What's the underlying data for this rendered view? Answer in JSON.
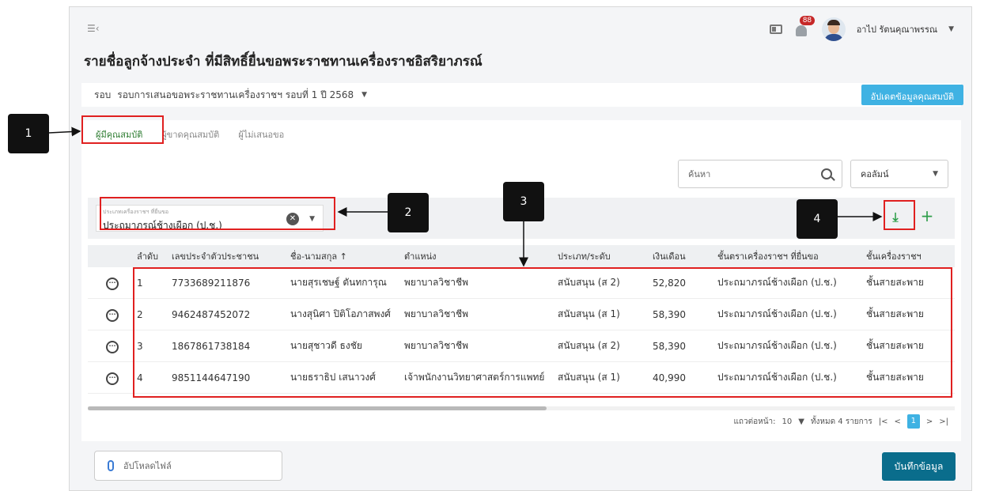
{
  "header": {
    "menu_icon": "menu-collapse-icon",
    "notification_count": "88",
    "user_name": "อาไป รัตนคุณาพรรณ",
    "page_title": "รายชื่อลูกจ้างประจำ ที่มีสิทธิ์ยื่นขอพระราชทานเครื่องราชอิสริยาภรณ์"
  },
  "round": {
    "label": "รอบ",
    "value": "รอบการเสนอขอพระราชทานเครื่องราชฯ รอบที่ 1 ปี 2568",
    "update_button": "อัปเดตข้อมูลคุณสมบัติ"
  },
  "tabs": [
    {
      "label": "ผู้มีคุณสมบัติ",
      "active": true
    },
    {
      "label": "ผู้ขาดคุณสมบัติ",
      "active": false
    },
    {
      "label": "ผู้ไม่เสนอขอ",
      "active": false
    }
  ],
  "search": {
    "placeholder": "ค้นหา"
  },
  "column_select": {
    "label": "คอลัมน์"
  },
  "filter": {
    "label": "ประเภทเครื่องราชฯ ที่ยื่นขอ",
    "value": "ประถมาภรณ์ช้างเผือก (ป.ช.)"
  },
  "table": {
    "headers": [
      "",
      "ลำดับ",
      "เลขประจำตัวประชาชน",
      "ชื่อ-นามสกุล ↑",
      "ตำแหน่ง",
      "ประเภท/ระดับ",
      "เงินเดือน",
      "ชั้นตราเครื่องราชฯ ที่ยื่นขอ",
      "ชั้นเครื่องราชฯ"
    ],
    "rows": [
      [
        "1",
        "7733689211876",
        "นายสุรเชษฐ์ ตันทการุณ",
        "พยาบาลวิชาชีพ",
        "สนับสนุน (ส 2)",
        "52,820",
        "ประถมาภรณ์ช้างเผือก (ป.ช.)",
        "ชั้นสายสะพาย"
      ],
      [
        "2",
        "9462487452072",
        "นางสุนิศา ปิติโอภาสพงศ์",
        "พยาบาลวิชาชีพ",
        "สนับสนุน (ส 1)",
        "58,390",
        "ประถมาภรณ์ช้างเผือก (ป.ช.)",
        "ชั้นสายสะพาย"
      ],
      [
        "3",
        "1867861738184",
        "นายสุชาวดี ธงชัย",
        "พยาบาลวิชาชีพ",
        "สนับสนุน (ส 2)",
        "58,390",
        "ประถมาภรณ์ช้างเผือก (ป.ช.)",
        "ชั้นสายสะพาย"
      ],
      [
        "4",
        "9851144647190",
        "นายธราธิป เสนาวงศ์",
        "เจ้าพนักงานวิทยาศาสตร์การแพทย์",
        "สนับสนุน (ส 1)",
        "40,990",
        "ประถมาภรณ์ช้างเผือก (ป.ช.)",
        "ชั้นสายสะพาย"
      ]
    ]
  },
  "pagination": {
    "per_page_label": "แถวต่อหน้า:",
    "per_page": "10",
    "total_label": "ทั้งหมด 4 รายการ",
    "first": "|<",
    "prev": "<",
    "current": "1",
    "next": ">",
    "last": ">|"
  },
  "footer": {
    "upload_label": "อัปโหลดไฟล์",
    "save_button": "บันทึกข้อมูล"
  },
  "callouts": [
    "1",
    "2",
    "3",
    "4"
  ],
  "colors": {
    "highlight": "#e02020",
    "accent": "#3fb2e3",
    "primary": "#0a6d8c",
    "active_tab": "#2e7d32"
  }
}
